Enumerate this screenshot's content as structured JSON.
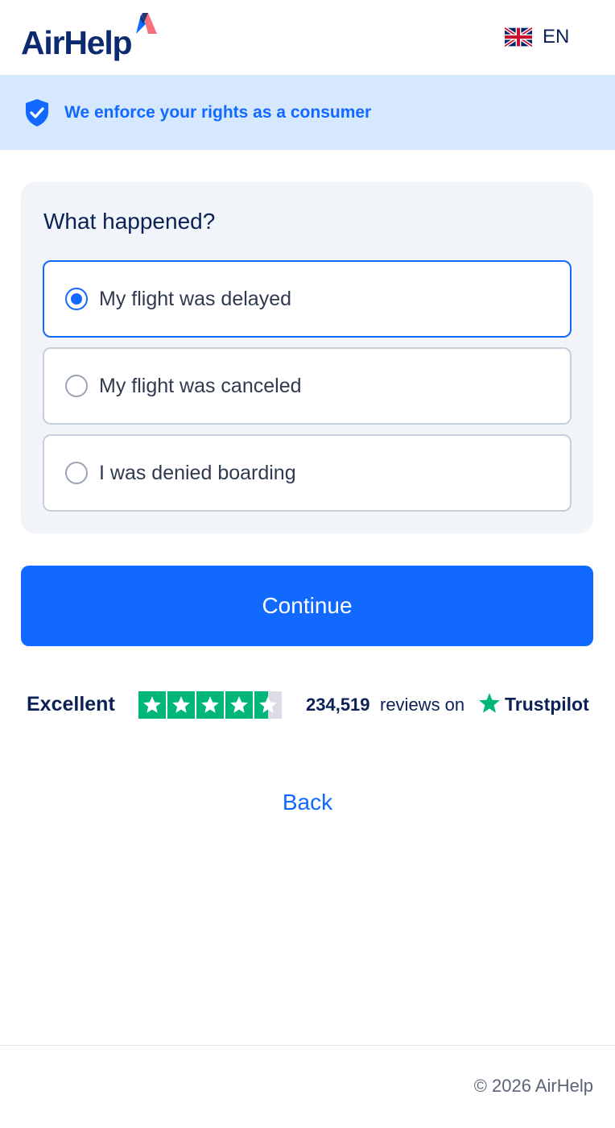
{
  "header": {
    "logo_text": "AirHelp",
    "language_code": "EN"
  },
  "banner": {
    "text": "We enforce your rights as a consumer",
    "icon": "shield-check-icon"
  },
  "form": {
    "title": "What happened?",
    "options": [
      {
        "label": "My flight was delayed",
        "selected": true
      },
      {
        "label": "My flight was canceled",
        "selected": false
      },
      {
        "label": "I was denied boarding",
        "selected": false
      }
    ],
    "continue_label": "Continue"
  },
  "trustpilot": {
    "rating_label": "Excellent",
    "stars": 4.5,
    "review_count": "234,519",
    "reviews_on": "reviews on",
    "brand": "Trustpilot"
  },
  "back_label": "Back",
  "footer": {
    "copyright": "© 2026 AirHelp"
  },
  "colors": {
    "primary": "#1169ff",
    "navy": "#0b2156",
    "banner_bg": "#d6e8fd",
    "card_bg": "#f1f4f9",
    "trustpilot_green": "#00b67a"
  }
}
